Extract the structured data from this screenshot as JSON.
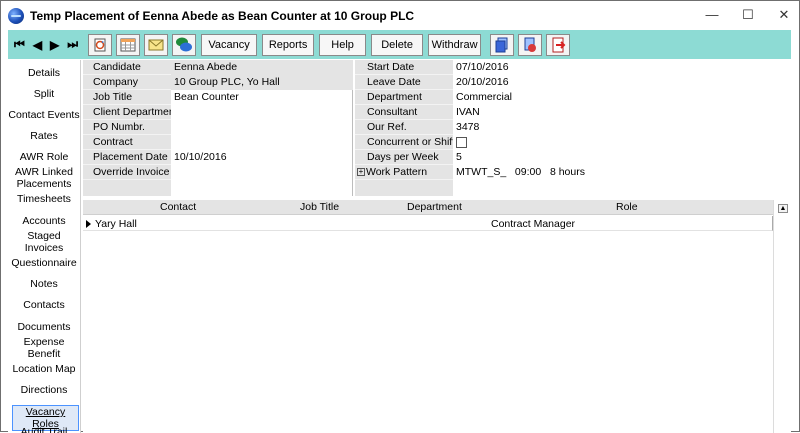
{
  "window": {
    "title": "Temp Placement of Eenna Abede as Bean Counter at 10 Group PLC",
    "controls": [
      "—",
      "☐",
      "✕"
    ]
  },
  "toolbar": {
    "nav": [
      "⏮",
      "◀",
      "▶",
      "⏭"
    ],
    "icons": [
      "refresh-icon",
      "calendar-grid-icon",
      "envelope-icon",
      "chat-bubbles-icon"
    ],
    "buttons": [
      "Vacancy",
      "Reports",
      "Help",
      "Delete",
      "Withdraw"
    ],
    "right_icons": [
      "document-stack-icon",
      "document-refresh-icon",
      "exit-icon"
    ]
  },
  "sidebar": {
    "items": [
      {
        "label": "Details"
      },
      {
        "label": "Split"
      },
      {
        "label": "Contact Events"
      },
      {
        "label": "Rates"
      },
      {
        "label": "AWR Role"
      },
      {
        "label": "AWR Linked Placements"
      },
      {
        "label": "Timesheets"
      },
      {
        "label": "Accounts"
      },
      {
        "label": "Staged Invoices"
      },
      {
        "label": "Questionnaire"
      },
      {
        "label": "Notes"
      },
      {
        "label": "Contacts"
      },
      {
        "label": "Documents"
      },
      {
        "label": "Expense Benefit"
      },
      {
        "label": "Location Map"
      },
      {
        "label": "Directions"
      },
      {
        "label": "Vacancy Roles"
      },
      {
        "label": "Audit Trail"
      }
    ]
  },
  "form_left": [
    {
      "label": "Candidate",
      "value": "Eenna Abede"
    },
    {
      "label": "Company",
      "value": "10 Group PLC, Yo Hall"
    },
    {
      "label": "Job Title",
      "value": "Bean Counter"
    },
    {
      "label": "Client Department",
      "value": ""
    },
    {
      "label": "PO Numbr.",
      "value": ""
    },
    {
      "label": "Contract",
      "value": ""
    },
    {
      "label": "Placement Date",
      "value": "10/10/2016"
    },
    {
      "label": "Override Invoice L",
      "value": ""
    }
  ],
  "form_right": [
    {
      "label": "Start Date",
      "value": "07/10/2016"
    },
    {
      "label": "Leave Date",
      "value": "20/10/2016"
    },
    {
      "label": "Department",
      "value": "Commercial"
    },
    {
      "label": "Consultant",
      "value": "IVAN"
    },
    {
      "label": "Our Ref.",
      "value": "3478"
    },
    {
      "label": "Concurrent or Shifts",
      "value": ""
    },
    {
      "label": "Days per Week",
      "value": "5"
    },
    {
      "label": "Work Pattern",
      "value": "MTWT_S_   09:00   8 hours"
    }
  ],
  "grid": {
    "columns": [
      "Contact",
      "Job Title",
      "Department",
      "Role"
    ],
    "rows": [
      {
        "contact": "Yary Hall",
        "job_title": "",
        "department": "",
        "role": "Contract Manager"
      }
    ]
  }
}
